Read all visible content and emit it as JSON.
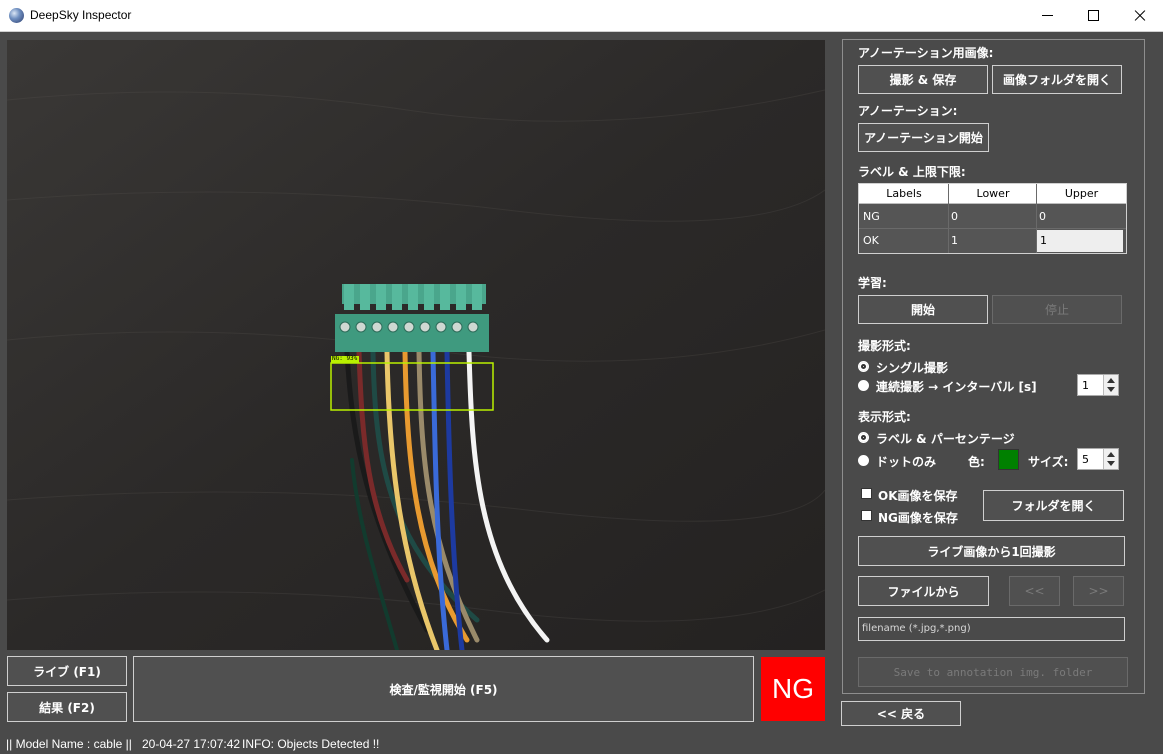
{
  "window": {
    "title": "DeepSky Inspector"
  },
  "preview": {
    "detection_label": "NG: 93%",
    "box_color": "#b9f000"
  },
  "bottom": {
    "live_button": "ライブ (F1)",
    "result_button": "結果 (F2)",
    "inspect_button": "検査/監視開始 (F5)",
    "result_badge": "NG",
    "result_badge_color": "#ff0000",
    "back_button": "<< 戻る"
  },
  "panel": {
    "annotation_image_label": "アノーテーション用画像:",
    "capture_save_button": "撮影 & 保存",
    "open_image_folder_button": "画像フォルダを開く",
    "annotation_label": "アノーテーション:",
    "annotation_start_button": "アノーテーション開始",
    "label_limits_label": "ラベル & 上限下限:",
    "table": {
      "headers": [
        "Labels",
        "Lower",
        "Upper"
      ],
      "rows": [
        {
          "label": "NG",
          "lower": "0",
          "upper": "0"
        },
        {
          "label": "OK",
          "lower": "1",
          "upper": "1"
        }
      ]
    },
    "training_label": "学習:",
    "train_start_button": "開始",
    "train_stop_button": "停止",
    "capture_mode_label": "撮影形式:",
    "single_capture": "シングル撮影",
    "continuous_capture": "連続撮影 → インターバル [s]",
    "interval_value": "1",
    "display_mode_label": "表示形式:",
    "label_percentage": "ラベル & パーセンテージ",
    "dots_only": "ドットのみ",
    "color_label": "色:",
    "color_value": "#008000",
    "size_label": "サイズ:",
    "size_value": "5",
    "save_ok_images": "OK画像を保存",
    "save_ng_images": "NG画像を保存",
    "open_folder_button": "フォルダを開く",
    "capture_once_button": "ライブ画像から1回撮影",
    "from_file_button": "ファイルから",
    "prev_button": "<<",
    "next_button": ">>",
    "filename_value": "filename (*.jpg,*.png)",
    "save_annotation_button": "Save to annotation img. folder"
  },
  "status": {
    "model": "|| Model Name : cable ||",
    "timestamp": "20-04-27 17:07:42",
    "info": "INFO:   Objects Detected !!"
  }
}
